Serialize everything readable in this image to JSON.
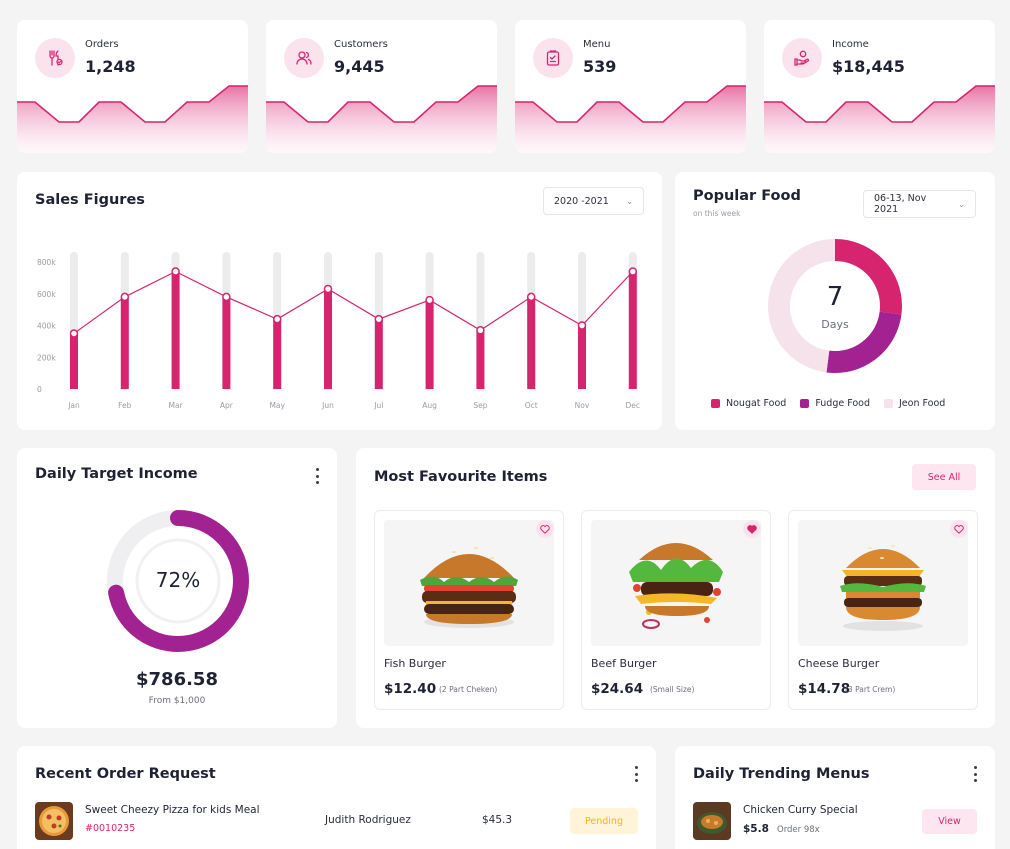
{
  "stats": [
    {
      "label": "Orders",
      "value": "1,248",
      "icon": "fork-knife-icon"
    },
    {
      "label": "Customers",
      "value": "9,445",
      "icon": "users-icon"
    },
    {
      "label": "Menu",
      "value": "539",
      "icon": "menu-clipboard-icon"
    },
    {
      "label": "Income",
      "value": "$18,445",
      "icon": "income-hand-icon"
    }
  ],
  "colors": {
    "accent": "#d6246f",
    "purple": "#a32292",
    "light_pink": "#f6e2ea",
    "track": "#ececec"
  },
  "sales": {
    "title": "Sales Figures",
    "period": "2020 -2021"
  },
  "chart_data": {
    "type": "bar",
    "title": "Sales Figures",
    "categories": [
      "Jan",
      "Feb",
      "Mar",
      "Apr",
      "May",
      "Jun",
      "Jul",
      "Aug",
      "Sep",
      "Oct",
      "Nov",
      "Dec"
    ],
    "values": [
      350,
      580,
      740,
      580,
      440,
      630,
      440,
      560,
      370,
      580,
      400,
      740
    ],
    "max": 800,
    "yticks": [
      "800k",
      "600k",
      "400k",
      "200k",
      "0"
    ],
    "ylim": [
      0,
      800
    ],
    "line_overlay": true
  },
  "popular": {
    "title": "Popular Food",
    "subtitle": "on this week",
    "period": "06-13, Nov 2021",
    "center_value": "7",
    "center_label": "Days",
    "legend": [
      {
        "name": "Nougat Food",
        "color": "#d6246f"
      },
      {
        "name": "Fudge Food",
        "color": "#a32292"
      },
      {
        "name": "Jeon Food",
        "color": "#f6e2ea"
      }
    ],
    "shares": [
      0.27,
      0.25,
      0.48
    ]
  },
  "daily": {
    "title": "Daily Target Income",
    "percent_label": "72%",
    "percent": 0.72,
    "amount": "$786.58",
    "from": "From $1,000"
  },
  "favourites": {
    "title": "Most Favourite Items",
    "see_all": "See All",
    "items": [
      {
        "name": "Fish Burger",
        "price": "$12.40",
        "note": "(2 Part Cheken)",
        "liked": false
      },
      {
        "name": "Beef Burger",
        "price": "$24.64",
        "note": "(Small Size)",
        "liked": true
      },
      {
        "name": "Cheese Burger",
        "price": "$14.78",
        "note": "(3 Part Crem)",
        "liked": false
      }
    ]
  },
  "recent": {
    "title": "Recent Order Request",
    "rows": [
      {
        "item": "Sweet Cheezy Pizza for kids Meal",
        "id": "#0010235",
        "customer": "Judith Rodriguez",
        "amount": "$45.3",
        "status": "Pending"
      }
    ]
  },
  "trending": {
    "title": "Daily Trending Menus",
    "rows": [
      {
        "name": "Chicken Curry Special",
        "price": "$5.8",
        "orders": "Order 98x",
        "action": "View"
      }
    ]
  }
}
